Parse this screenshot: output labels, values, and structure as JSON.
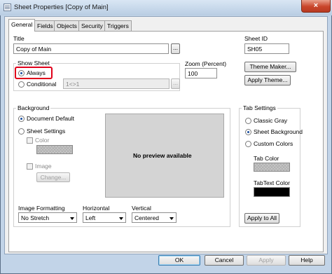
{
  "window": {
    "title": "Sheet Properties [Copy of Main]",
    "close_glyph": "×"
  },
  "tabs": [
    {
      "label": "General"
    },
    {
      "label": "Fields"
    },
    {
      "label": "Objects"
    },
    {
      "label": "Security"
    },
    {
      "label": "Triggers"
    }
  ],
  "general": {
    "title_label": "Title",
    "title_value": "Copy of Main",
    "title_button": "...",
    "sheet_id_label": "Sheet ID",
    "sheet_id_value": "SH05",
    "show_sheet": {
      "label": "Show Sheet",
      "always": "Always",
      "conditional": "Conditional",
      "condition_value": "1<>1",
      "condition_button": "..."
    },
    "zoom_label": "Zoom (Percent)",
    "zoom_value": "100",
    "theme_maker_button": "Theme Maker...",
    "apply_theme_button": "Apply Theme...",
    "background": {
      "label": "Background",
      "document_default": "Document Default",
      "sheet_settings": "Sheet Settings",
      "color": "Color",
      "image": "Image",
      "change_button": "Change...",
      "preview_text": "No preview available"
    },
    "image_formatting": {
      "label": "Image Formatting",
      "value": "No Stretch"
    },
    "horizontal": {
      "label": "Horizontal",
      "value": "Left"
    },
    "vertical": {
      "label": "Vertical",
      "value": "Centered"
    },
    "tab_settings": {
      "label": "Tab Settings",
      "classic_gray": "Classic Gray",
      "sheet_background": "Sheet Background",
      "custom_colors": "Custom Colors",
      "tab_color": "Tab Color",
      "tab_text_color": "TabText Color",
      "apply_to_all_button": "Apply to All"
    }
  },
  "footer": {
    "ok": "OK",
    "cancel": "Cancel",
    "apply": "Apply",
    "help": "Help"
  },
  "colors": {
    "tab_text_swatch": "#000000",
    "highlight": "#e0001b"
  }
}
